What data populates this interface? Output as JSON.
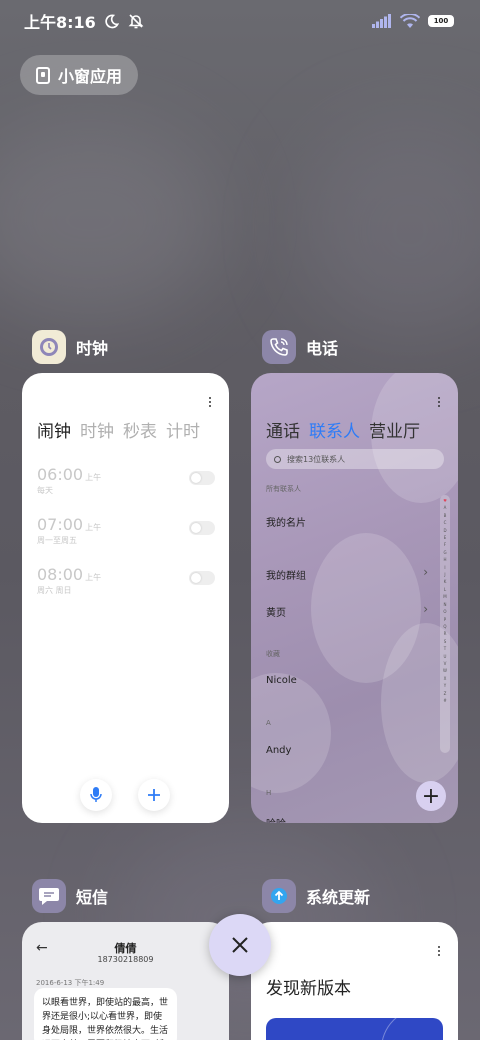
{
  "status_bar": {
    "time": "上午8:16",
    "battery": "100"
  },
  "pip_button": {
    "label": "小窗应用"
  },
  "apps": {
    "clock": {
      "name": "时钟",
      "tabs": [
        "闹钟",
        "时钟",
        "秒表",
        "计时"
      ],
      "alarms": [
        {
          "time": "06:00",
          "ampm": "上午",
          "repeat": "每天"
        },
        {
          "time": "07:00",
          "ampm": "上午",
          "repeat": "周一至周五"
        },
        {
          "time": "08:00",
          "ampm": "上午",
          "repeat": "周六 周日"
        }
      ]
    },
    "phone": {
      "name": "电话",
      "tabs": [
        "通话",
        "联系人",
        "营业厅"
      ],
      "search_placeholder": "搜索13位联系人",
      "all_contacts": "所有联系人",
      "my_card": "我的名片",
      "my_groups": "我的群组",
      "yellow_pages": "黄页",
      "section_favorites": "收藏",
      "contact_1": "Nicole",
      "section_a": "A",
      "contact_2": "Andy",
      "section_h": "H",
      "contact_3": "哈哈",
      "index_letters": [
        "♥",
        "A",
        "B",
        "C",
        "D",
        "E",
        "F",
        "G",
        "H",
        "I",
        "J",
        "K",
        "L",
        "M",
        "N",
        "O",
        "P",
        "Q",
        "R",
        "S",
        "T",
        "U",
        "V",
        "W",
        "X",
        "Y",
        "Z",
        "#"
      ]
    },
    "sms": {
      "name": "短信",
      "contact_name": "倩倩",
      "contact_number": "18730218809",
      "date": "2016-6-13 下午1:49",
      "message": "以眼看世界，即使站的最高，世界还是很小;以心看世界，即使身处局限，世界依然很大。生活远不完美，需要积极地去面对和改变"
    },
    "update": {
      "name": "系统更新",
      "title": "发现新版本"
    }
  },
  "colors": {
    "accent": "#2f7cf6",
    "close_button": "#dcd8f6"
  }
}
